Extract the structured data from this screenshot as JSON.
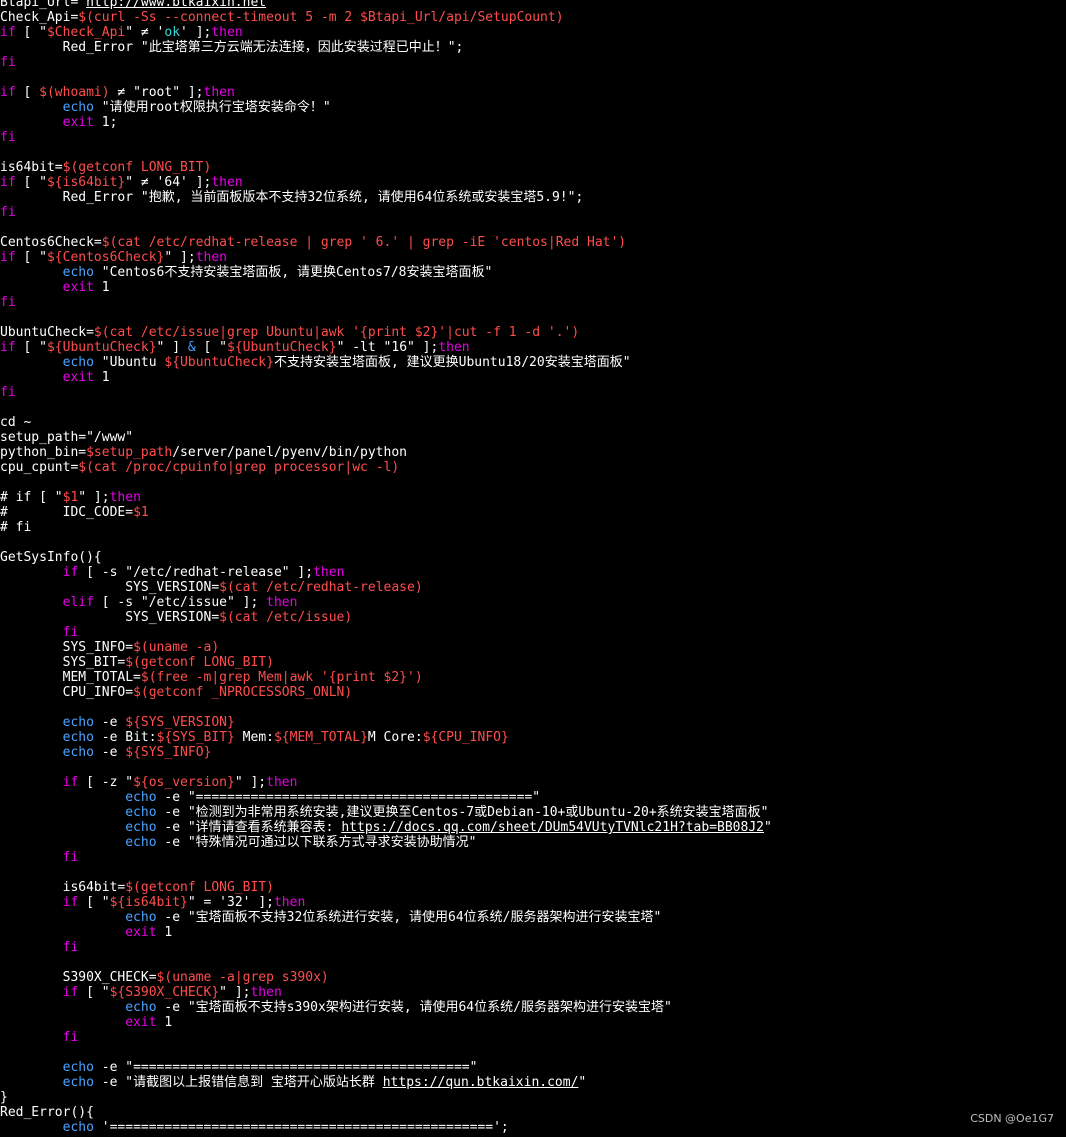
{
  "terminal": {
    "lines": [
      [
        {
          "t": "Btapi_Url='",
          "c": "w"
        },
        {
          "t": "http://www.btkaixin.net",
          "c": "u"
        },
        {
          "t": "'",
          "c": "w"
        }
      ],
      [
        {
          "t": "Check_Api=",
          "c": "w"
        },
        {
          "t": "$(curl -Ss --connect-timeout 5 -m 2 $Btapi_Url/api/SetupCount)",
          "c": "v"
        }
      ],
      [
        {
          "t": "if",
          "c": "k"
        },
        {
          "t": " [ \"",
          "c": "w"
        },
        {
          "t": "$Check_Api",
          "c": "v"
        },
        {
          "t": "\" ≠ '",
          "c": "w"
        },
        {
          "t": "ok",
          "c": "g"
        },
        {
          "t": "' ];",
          "c": "w"
        },
        {
          "t": "then",
          "c": "k"
        }
      ],
      [
        {
          "t": "        Red_Error \"此宝塔第三方云端无法连接，因此安装过程已中止！\";",
          "c": "w"
        }
      ],
      [
        {
          "t": "fi",
          "c": "k"
        }
      ],
      [],
      [
        {
          "t": "if",
          "c": "k"
        },
        {
          "t": " [ ",
          "c": "w"
        },
        {
          "t": "$(whoami)",
          "c": "v"
        },
        {
          "t": " ≠ \"root\" ];",
          "c": "w"
        },
        {
          "t": "then",
          "c": "k"
        }
      ],
      [
        {
          "t": "        ",
          "c": "w"
        },
        {
          "t": "echo",
          "c": "e"
        },
        {
          "t": " \"请使用root权限执行宝塔安装命令！\"",
          "c": "w"
        }
      ],
      [
        {
          "t": "        ",
          "c": "w"
        },
        {
          "t": "exit",
          "c": "k"
        },
        {
          "t": " 1;",
          "c": "w"
        }
      ],
      [
        {
          "t": "fi",
          "c": "k"
        }
      ],
      [],
      [
        {
          "t": "is64bit=",
          "c": "w"
        },
        {
          "t": "$(getconf LONG_BIT)",
          "c": "v"
        }
      ],
      [
        {
          "t": "if",
          "c": "k"
        },
        {
          "t": " [ \"",
          "c": "w"
        },
        {
          "t": "${is64bit}",
          "c": "v"
        },
        {
          "t": "\" ≠ '64' ];",
          "c": "w"
        },
        {
          "t": "then",
          "c": "k"
        }
      ],
      [
        {
          "t": "        Red_Error \"抱歉, 当前面板版本不支持32位系统, 请使用64位系统或安装宝塔5.9!\";",
          "c": "w"
        }
      ],
      [
        {
          "t": "fi",
          "c": "k"
        }
      ],
      [],
      [
        {
          "t": "Centos6Check=",
          "c": "w"
        },
        {
          "t": "$(cat /etc/redhat-release | grep ' 6.' | grep -iE 'centos|Red Hat')",
          "c": "v"
        }
      ],
      [
        {
          "t": "if",
          "c": "k"
        },
        {
          "t": " [ \"",
          "c": "w"
        },
        {
          "t": "${Centos6Check}",
          "c": "v"
        },
        {
          "t": "\" ];",
          "c": "w"
        },
        {
          "t": "then",
          "c": "k"
        }
      ],
      [
        {
          "t": "        ",
          "c": "w"
        },
        {
          "t": "echo",
          "c": "e"
        },
        {
          "t": " \"Centos6不支持安装宝塔面板, 请更换Centos7/8安装宝塔面板\"",
          "c": "w"
        }
      ],
      [
        {
          "t": "        ",
          "c": "w"
        },
        {
          "t": "exit",
          "c": "k"
        },
        {
          "t": " 1",
          "c": "w"
        }
      ],
      [
        {
          "t": "fi",
          "c": "k"
        }
      ],
      [],
      [
        {
          "t": "UbuntuCheck=",
          "c": "w"
        },
        {
          "t": "$(cat /etc/issue|grep Ubuntu|awk '{print $2}'|cut -f 1 -d '.')",
          "c": "v"
        }
      ],
      [
        {
          "t": "if",
          "c": "k"
        },
        {
          "t": " [ \"",
          "c": "w"
        },
        {
          "t": "${UbuntuCheck}",
          "c": "v"
        },
        {
          "t": "\" ] ",
          "c": "w"
        },
        {
          "t": "&",
          "c": "e"
        },
        {
          "t": " [ \"",
          "c": "w"
        },
        {
          "t": "${UbuntuCheck}",
          "c": "v"
        },
        {
          "t": "\" -lt \"16\" ];",
          "c": "w"
        },
        {
          "t": "then",
          "c": "k"
        }
      ],
      [
        {
          "t": "        ",
          "c": "w"
        },
        {
          "t": "echo",
          "c": "e"
        },
        {
          "t": " \"Ubuntu ",
          "c": "w"
        },
        {
          "t": "${UbuntuCheck}",
          "c": "v"
        },
        {
          "t": "不支持安装宝塔面板, 建议更换Ubuntu18/20安装宝塔面板\"",
          "c": "w"
        }
      ],
      [
        {
          "t": "        ",
          "c": "w"
        },
        {
          "t": "exit",
          "c": "k"
        },
        {
          "t": " 1",
          "c": "w"
        }
      ],
      [
        {
          "t": "fi",
          "c": "k"
        }
      ],
      [],
      [
        {
          "t": "cd ~",
          "c": "w"
        }
      ],
      [
        {
          "t": "setup_path=\"/www\"",
          "c": "w"
        }
      ],
      [
        {
          "t": "python_bin=",
          "c": "w"
        },
        {
          "t": "$setup_path",
          "c": "v"
        },
        {
          "t": "/server/panel/pyenv/bin/python",
          "c": "w"
        }
      ],
      [
        {
          "t": "cpu_cpunt=",
          "c": "w"
        },
        {
          "t": "$(cat /proc/cpuinfo|grep processor|wc -l)",
          "c": "v"
        }
      ],
      [],
      [
        {
          "t": "# if [ \"",
          "c": "w"
        },
        {
          "t": "$1",
          "c": "v"
        },
        {
          "t": "\" ];",
          "c": "w"
        },
        {
          "t": "then",
          "c": "k"
        }
      ],
      [
        {
          "t": "#       IDC_CODE=",
          "c": "w"
        },
        {
          "t": "$1",
          "c": "v"
        }
      ],
      [
        {
          "t": "# fi",
          "c": "w"
        }
      ],
      [],
      [
        {
          "t": "GetSysInfo(){",
          "c": "w"
        }
      ],
      [
        {
          "t": "        ",
          "c": "w"
        },
        {
          "t": "if",
          "c": "k"
        },
        {
          "t": " [ -s \"/etc/redhat-release\" ];",
          "c": "w"
        },
        {
          "t": "then",
          "c": "k"
        }
      ],
      [
        {
          "t": "                SYS_VERSION=",
          "c": "w"
        },
        {
          "t": "$(cat /etc/redhat-release)",
          "c": "v"
        }
      ],
      [
        {
          "t": "        ",
          "c": "w"
        },
        {
          "t": "elif",
          "c": "k"
        },
        {
          "t": " [ -s \"/etc/issue\" ]; ",
          "c": "w"
        },
        {
          "t": "then",
          "c": "k"
        }
      ],
      [
        {
          "t": "                SYS_VERSION=",
          "c": "w"
        },
        {
          "t": "$(cat /etc/issue)",
          "c": "v"
        }
      ],
      [
        {
          "t": "        ",
          "c": "w"
        },
        {
          "t": "fi",
          "c": "k"
        }
      ],
      [
        {
          "t": "        SYS_INFO=",
          "c": "w"
        },
        {
          "t": "$(uname -a)",
          "c": "v"
        }
      ],
      [
        {
          "t": "        SYS_BIT=",
          "c": "w"
        },
        {
          "t": "$(getconf LONG_BIT)",
          "c": "v"
        }
      ],
      [
        {
          "t": "        MEM_TOTAL=",
          "c": "w"
        },
        {
          "t": "$(free -m|grep Mem|awk '{print $2}')",
          "c": "v"
        }
      ],
      [
        {
          "t": "        CPU_INFO=",
          "c": "w"
        },
        {
          "t": "$(getconf _NPROCESSORS_ONLN)",
          "c": "v"
        }
      ],
      [],
      [
        {
          "t": "        ",
          "c": "w"
        },
        {
          "t": "echo",
          "c": "e"
        },
        {
          "t": " -e ",
          "c": "w"
        },
        {
          "t": "${SYS_VERSION}",
          "c": "v"
        }
      ],
      [
        {
          "t": "        ",
          "c": "w"
        },
        {
          "t": "echo",
          "c": "e"
        },
        {
          "t": " -e Bit:",
          "c": "w"
        },
        {
          "t": "${SYS_BIT}",
          "c": "v"
        },
        {
          "t": " Mem:",
          "c": "w"
        },
        {
          "t": "${MEM_TOTAL}",
          "c": "v"
        },
        {
          "t": "M Core:",
          "c": "w"
        },
        {
          "t": "${CPU_INFO}",
          "c": "v"
        }
      ],
      [
        {
          "t": "        ",
          "c": "w"
        },
        {
          "t": "echo",
          "c": "e"
        },
        {
          "t": " -e ",
          "c": "w"
        },
        {
          "t": "${SYS_INFO}",
          "c": "v"
        }
      ],
      [],
      [
        {
          "t": "        ",
          "c": "w"
        },
        {
          "t": "if",
          "c": "k"
        },
        {
          "t": " [ -z \"",
          "c": "w"
        },
        {
          "t": "${os_version}",
          "c": "v"
        },
        {
          "t": "\" ];",
          "c": "w"
        },
        {
          "t": "then",
          "c": "k"
        }
      ],
      [
        {
          "t": "                ",
          "c": "w"
        },
        {
          "t": "echo",
          "c": "e"
        },
        {
          "t": " -e \"===========================================\"",
          "c": "w"
        }
      ],
      [
        {
          "t": "                ",
          "c": "w"
        },
        {
          "t": "echo",
          "c": "e"
        },
        {
          "t": " -e \"检测到为非常用系统安装,建议更换至Centos-7或Debian-10+或Ubuntu-20+系统安装宝塔面板\"",
          "c": "w"
        }
      ],
      [
        {
          "t": "                ",
          "c": "w"
        },
        {
          "t": "echo",
          "c": "e"
        },
        {
          "t": " -e \"详情请查看系统兼容表: ",
          "c": "w"
        },
        {
          "t": "https://docs.qq.com/sheet/DUm54VUtyTVNlc21H?tab=BB08J2",
          "c": "u"
        },
        {
          "t": "\"",
          "c": "w"
        }
      ],
      [
        {
          "t": "                ",
          "c": "w"
        },
        {
          "t": "echo",
          "c": "e"
        },
        {
          "t": " -e \"特殊情况可通过以下联系方式寻求安装协助情况\"",
          "c": "w"
        }
      ],
      [
        {
          "t": "        ",
          "c": "w"
        },
        {
          "t": "fi",
          "c": "k"
        }
      ],
      [],
      [
        {
          "t": "        is64bit=",
          "c": "w"
        },
        {
          "t": "$(getconf LONG_BIT)",
          "c": "v"
        }
      ],
      [
        {
          "t": "        ",
          "c": "w"
        },
        {
          "t": "if",
          "c": "k"
        },
        {
          "t": " [ \"",
          "c": "w"
        },
        {
          "t": "${is64bit}",
          "c": "v"
        },
        {
          "t": "\" = '32' ];",
          "c": "w"
        },
        {
          "t": "then",
          "c": "k"
        }
      ],
      [
        {
          "t": "                ",
          "c": "w"
        },
        {
          "t": "echo",
          "c": "e"
        },
        {
          "t": " -e \"宝塔面板不支持32位系统进行安装, 请使用64位系统/服务器架构进行安装宝塔\"",
          "c": "w"
        }
      ],
      [
        {
          "t": "                ",
          "c": "w"
        },
        {
          "t": "exit",
          "c": "k"
        },
        {
          "t": " 1",
          "c": "w"
        }
      ],
      [
        {
          "t": "        ",
          "c": "w"
        },
        {
          "t": "fi",
          "c": "k"
        }
      ],
      [],
      [
        {
          "t": "        S390X_CHECK=",
          "c": "w"
        },
        {
          "t": "$(uname -a|grep s390x)",
          "c": "v"
        }
      ],
      [
        {
          "t": "        ",
          "c": "w"
        },
        {
          "t": "if",
          "c": "k"
        },
        {
          "t": " [ \"",
          "c": "w"
        },
        {
          "t": "${S390X_CHECK}",
          "c": "v"
        },
        {
          "t": "\" ];",
          "c": "w"
        },
        {
          "t": "then",
          "c": "k"
        }
      ],
      [
        {
          "t": "                ",
          "c": "w"
        },
        {
          "t": "echo",
          "c": "e"
        },
        {
          "t": " -e \"宝塔面板不支持s390x架构进行安装, 请使用64位系统/服务器架构进行安装宝塔\"",
          "c": "w"
        }
      ],
      [
        {
          "t": "                ",
          "c": "w"
        },
        {
          "t": "exit",
          "c": "k"
        },
        {
          "t": " 1",
          "c": "w"
        }
      ],
      [
        {
          "t": "        ",
          "c": "w"
        },
        {
          "t": "fi",
          "c": "k"
        }
      ],
      [],
      [
        {
          "t": "        ",
          "c": "w"
        },
        {
          "t": "echo",
          "c": "e"
        },
        {
          "t": " -e \"===========================================\"",
          "c": "w"
        }
      ],
      [
        {
          "t": "        ",
          "c": "w"
        },
        {
          "t": "echo",
          "c": "e"
        },
        {
          "t": " -e \"请截图以上报错信息到 宝塔开心版站长群 ",
          "c": "w"
        },
        {
          "t": "https://qun.btkaixin.com/",
          "c": "u"
        },
        {
          "t": "\"",
          "c": "w"
        }
      ],
      [
        {
          "t": "}",
          "c": "w"
        }
      ],
      [
        {
          "t": "Red_Error(){",
          "c": "w"
        }
      ],
      [
        {
          "t": "        ",
          "c": "w"
        },
        {
          "t": "echo",
          "c": "e"
        },
        {
          "t": " '=================================================';",
          "c": "w"
        }
      ]
    ]
  },
  "watermark": "CSDN @Oe1G7",
  "colors": {
    "background": "#000000",
    "text": "#ffffff",
    "keyword": "#e600e6",
    "variable": "#ff4d4d",
    "string_literal": "#33d6d6",
    "command": "#4aa3ff"
  }
}
